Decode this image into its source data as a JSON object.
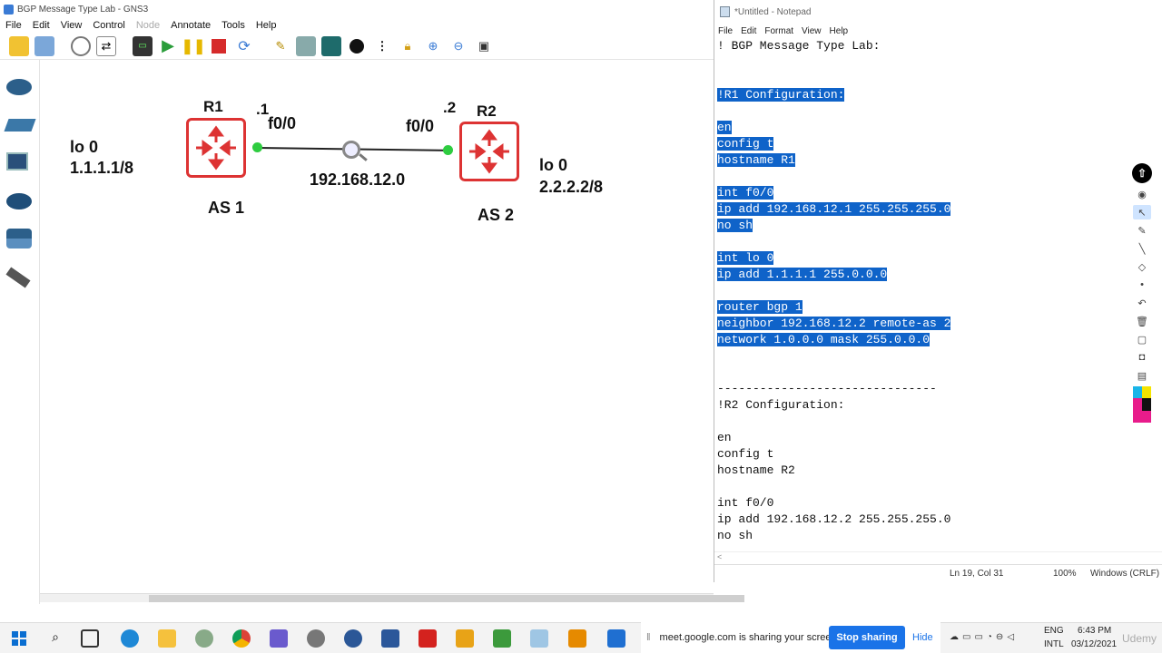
{
  "gns3": {
    "title": "BGP Message Type Lab - GNS3",
    "menu": [
      "File",
      "Edit",
      "View",
      "Control",
      "Node",
      "Annotate",
      "Tools",
      "Help"
    ]
  },
  "topology": {
    "r1_name": "R1",
    "r2_name": "R2",
    "r1_port_ip": ".1",
    "r1_iface": "f0/0",
    "r2_port_ip": ".2",
    "r2_iface": "f0/0",
    "network": "192.168.12.0",
    "r1_lo_name": "lo 0",
    "r1_lo_addr": "1.1.1.1/8",
    "r2_lo_name": "lo 0",
    "r2_lo_addr": "2.2.2.2/8",
    "r1_as": "AS 1",
    "r2_as": "AS 2"
  },
  "notepad": {
    "title": "*Untitled - Notepad",
    "menu": [
      "File",
      "Edit",
      "Format",
      "View",
      "Help"
    ],
    "lines": [
      {
        "text": "! BGP Message Type Lab:",
        "sel": false
      },
      {
        "text": "",
        "sel": false
      },
      {
        "text": "",
        "sel": false
      },
      {
        "text": "!R1 Configuration:",
        "sel": true
      },
      {
        "text": "",
        "sel": false
      },
      {
        "text": "en",
        "sel": true
      },
      {
        "text": "config t",
        "sel": true
      },
      {
        "text": "hostname R1",
        "sel": true
      },
      {
        "text": "",
        "sel": false
      },
      {
        "text": "int f0/0",
        "sel": true
      },
      {
        "text": "ip add 192.168.12.1 255.255.255.0",
        "sel": true
      },
      {
        "text": "no sh",
        "sel": true
      },
      {
        "text": "",
        "sel": false
      },
      {
        "text": "int lo 0",
        "sel": true
      },
      {
        "text": "ip add 1.1.1.1 255.0.0.0",
        "sel": true
      },
      {
        "text": "",
        "sel": false
      },
      {
        "text": "router bgp 1",
        "sel": true
      },
      {
        "text": "neighbor 192.168.12.2 remote-as 2",
        "sel": true
      },
      {
        "text": "network 1.0.0.0 mask 255.0.0.0",
        "sel": true
      },
      {
        "text": "",
        "sel": false
      },
      {
        "text": "",
        "sel": false
      },
      {
        "text": "-------------------------------",
        "sel": false
      },
      {
        "text": "!R2 Configuration:",
        "sel": false
      },
      {
        "text": "",
        "sel": false
      },
      {
        "text": "en",
        "sel": false
      },
      {
        "text": "config t",
        "sel": false
      },
      {
        "text": "hostname R2",
        "sel": false
      },
      {
        "text": "",
        "sel": false
      },
      {
        "text": "int f0/0",
        "sel": false
      },
      {
        "text": "ip add 192.168.12.2 255.255.255.0",
        "sel": false
      },
      {
        "text": "no sh",
        "sel": false
      }
    ],
    "status": {
      "position": "Ln 19, Col 31",
      "zoom": "100%",
      "line_endings": "Windows (CRLF)"
    }
  },
  "taskbar": {
    "share_message": "meet.google.com is sharing your screen.",
    "stop_label": "Stop sharing",
    "hide_label": "Hide",
    "lang1": "ENG",
    "lang2": "INTL",
    "time": "6:43 PM",
    "date": "03/12/2021"
  },
  "watermark": "Udemy"
}
